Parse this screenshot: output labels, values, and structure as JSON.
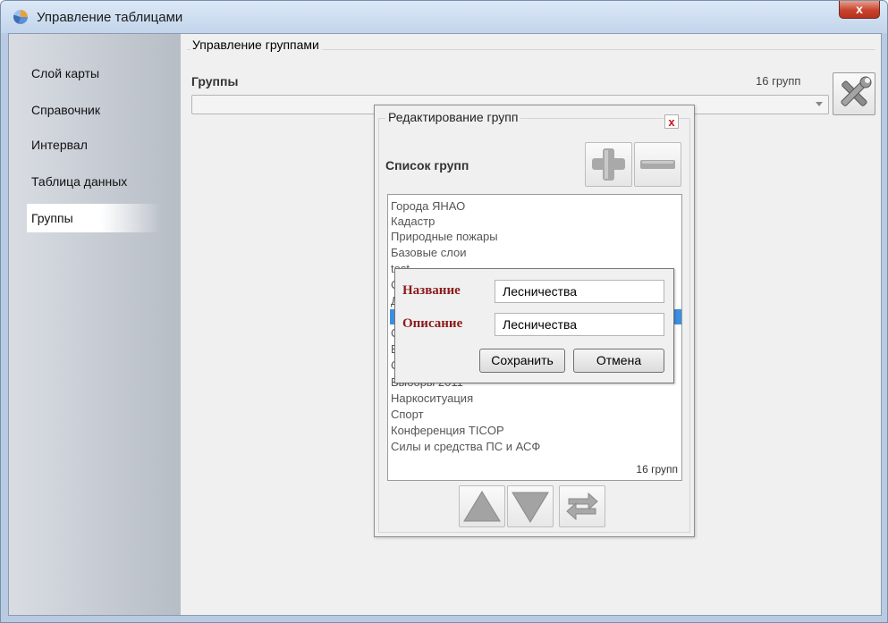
{
  "window": {
    "title": "Управление таблицами",
    "close_label": "x"
  },
  "sidebar": {
    "items": [
      {
        "label": "Слой карты"
      },
      {
        "label": "Справочник"
      },
      {
        "label": "Интервал"
      },
      {
        "label": "Таблица данных"
      },
      {
        "label": "Группы",
        "selected": true
      }
    ]
  },
  "group_management": {
    "legend": "Управление группами",
    "groups_label": "Группы",
    "count": "16 групп",
    "combo_value": "",
    "tools_icon": "tools-icon"
  },
  "edit_dialog": {
    "title": "Редактирование групп",
    "close_label": "x",
    "list_label": "Список групп",
    "list_items": [
      "Города ЯНАО",
      "Кадастр",
      "Природные пожары",
      "Базовые слои",
      "test",
      "С",
      "Д",
      "",
      "С",
      "Е",
      "С",
      "Выборы 2011",
      "Наркоситуация",
      "Спорт",
      "Конференция TICOP",
      "Силы и средства ПС и АСФ"
    ],
    "selected_index": 7,
    "list_count": "16 групп",
    "icons": [
      "plus-icon",
      "minus-icon",
      "arrow-up-icon",
      "arrow-down-icon",
      "swap-icon"
    ]
  },
  "edit_popup": {
    "name_label": "Название",
    "name_value": "Лесничества",
    "description_label": "Описание",
    "description_value": "Лесничества",
    "save_label": "Сохранить",
    "cancel_label": "Отмена"
  },
  "colors": {
    "selection": "#3d8fe0",
    "label_red": "#8b1a1a",
    "close_red": "#c7432c"
  }
}
